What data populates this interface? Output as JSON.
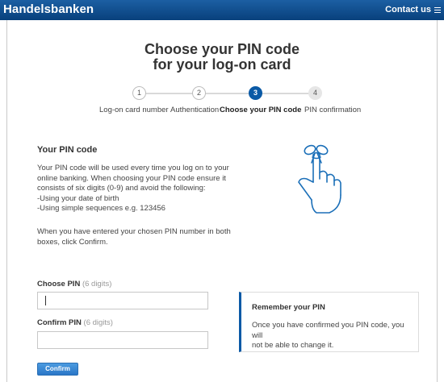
{
  "header": {
    "brand": "Handelsbanken",
    "contact_label": "Contact us",
    "menu_icon": "hamburger-menu-icon"
  },
  "page": {
    "title_line1": "Choose your PIN code",
    "title_line2": "for your log-on card"
  },
  "steps": [
    {
      "number": "1",
      "label": "Log-on card number",
      "state": "done"
    },
    {
      "number": "2",
      "label": "Authentication",
      "state": "done"
    },
    {
      "number": "3",
      "label": "Choose your PIN code",
      "state": "active"
    },
    {
      "number": "4",
      "label": "PIN confirmation",
      "state": "todo"
    }
  ],
  "info": {
    "heading": "Your PIN code",
    "lines": [
      "Your PIN code will be used every time you log on to your",
      "online banking. When choosing your PIN code ensure it",
      "consists of six digits (0-9) and avoid the following:",
      "-Using your date of birth",
      "-Using simple sequences e.g. 123456"
    ],
    "lines2": [
      "When you have entered your chosen PIN number in both",
      "boxes, click Confirm."
    ],
    "illustration_icon": "hand-with-string-icon"
  },
  "form": {
    "choose_label": "Choose PIN",
    "choose_hint": "(6 digits)",
    "choose_value": "",
    "confirm_label": "Confirm PIN",
    "confirm_hint": "(6 digits)",
    "confirm_value": "",
    "submit_label": "Confirm"
  },
  "notice": {
    "title": "Remember your PIN",
    "body_line1": "Once you have confirmed you PIN code, you will",
    "body_line2": "not be able to change it."
  },
  "colors": {
    "brand_blue": "#0b5aa6",
    "header_gradient_top": "#1c5fa3",
    "header_gradient_bottom": "#08407c"
  }
}
